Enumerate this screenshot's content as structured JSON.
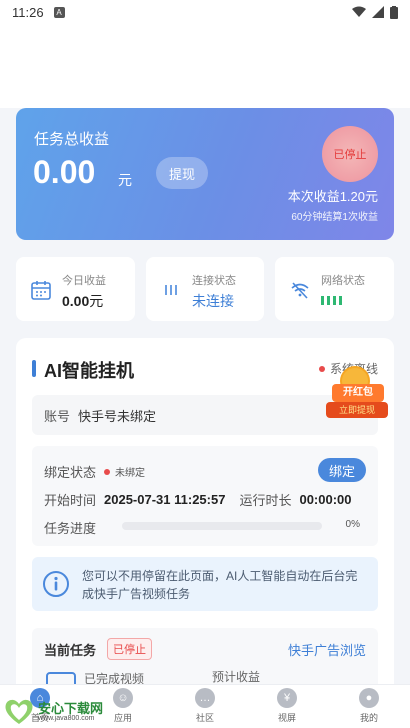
{
  "status_bar": {
    "time": "11:26"
  },
  "hero": {
    "label": "任务总收益",
    "amount": "0.00",
    "unit": "元",
    "withdraw_label": "提现",
    "status": "已停止",
    "this_income": "本次收益1.20元",
    "settle_note": "60分钟结算1次收益"
  },
  "stats": {
    "today": {
      "label": "今日收益",
      "value": "0.00",
      "unit": "元"
    },
    "connection": {
      "label": "连接状态",
      "value": "未连接"
    },
    "network": {
      "label": "网络状态"
    }
  },
  "panel": {
    "title": "AI智能挂机",
    "system_status": "系统离线",
    "account_label": "账号",
    "account_value": "快手号未绑定",
    "bind_status_label": "绑定状态",
    "bind_status_value": "未绑定",
    "bind_button": "绑定",
    "start_time_label": "开始时间",
    "start_time_value": "2025-07-31 11:25:57",
    "run_time_label": "运行时长",
    "run_time_value": "00:00:00",
    "progress_label": "任务进度",
    "progress_percent": "0%",
    "progress_fraction": 0,
    "info_text": "您可以不用停留在此页面，AI人工智能自动在后台完成快手广告视频任务",
    "current_task_label": "当前任务",
    "current_task_badge": "已停止",
    "current_task_link": "快手广告浏览",
    "completed_videos_label": "已完成视频",
    "estimated_income_label": "预计收益"
  },
  "promo": {
    "line1": "开红包",
    "line2": "立即提现"
  },
  "tabbar": {
    "items": [
      {
        "label": "首页"
      },
      {
        "label": "应用"
      },
      {
        "label": "社区"
      },
      {
        "label": "视屏"
      },
      {
        "label": "我的"
      }
    ]
  },
  "watermark": {
    "name": "安心下载网",
    "url": "www.java800.com"
  },
  "colors": {
    "accent": "#3e7fd6",
    "danger": "#e84b4b",
    "hero_start": "#5fa3ea",
    "hero_end": "#7f86e8"
  }
}
